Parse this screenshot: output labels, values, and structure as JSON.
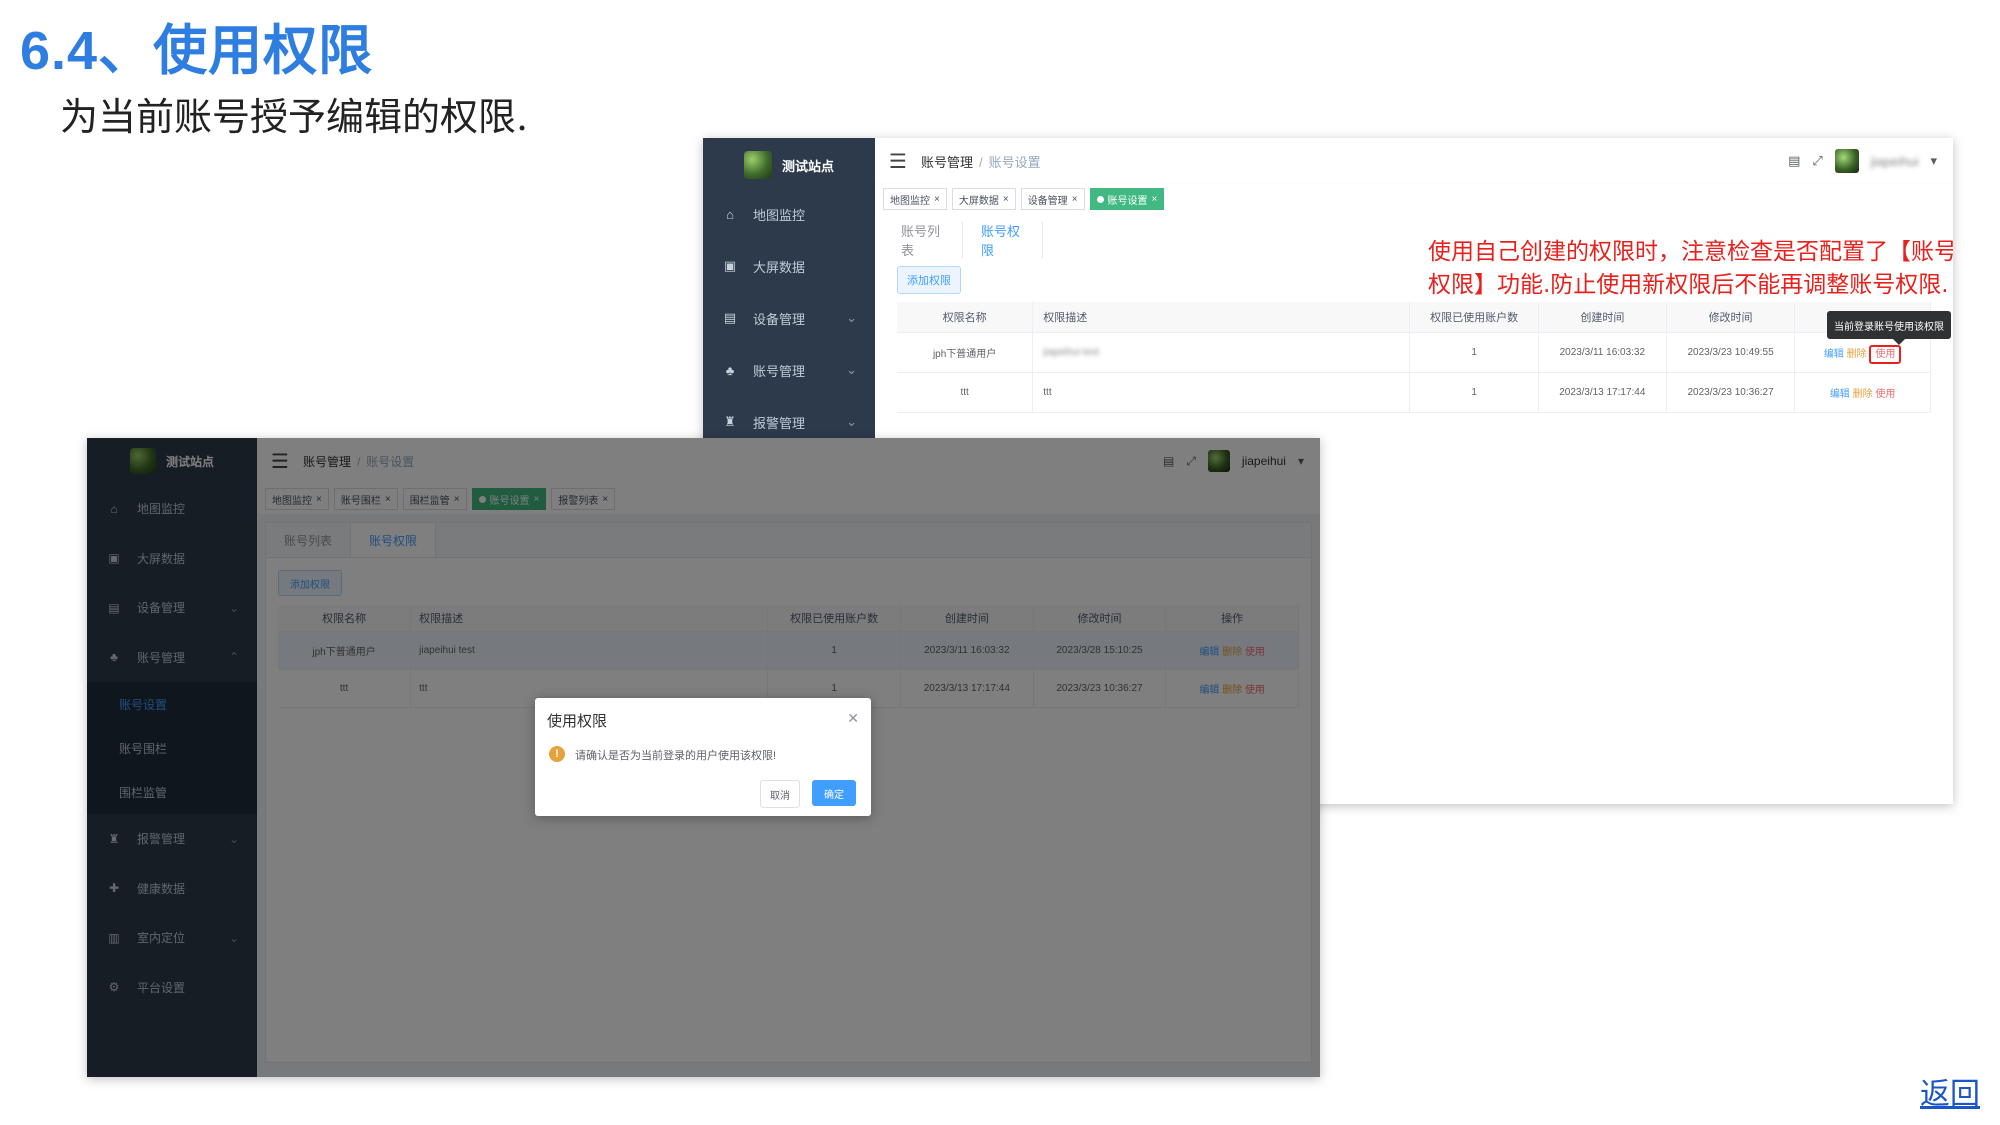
{
  "slide": {
    "title": "6.4、使用权限",
    "subtitle": "为当前账号授予编辑的权限.",
    "back_link": "返回"
  },
  "shot_back": {
    "logo_text": "测试站点",
    "menu": [
      "地图监控",
      "大屏数据",
      "设备管理",
      "账号管理",
      "报警管理"
    ],
    "breadcrumb": {
      "parent": "账号管理",
      "sep": "/",
      "current": "账号设置"
    },
    "user": "jiapeihui",
    "tags": [
      "地图监控",
      "大屏数据",
      "设备管理",
      "账号设置"
    ],
    "tabs": [
      "账号列表",
      "账号权限"
    ],
    "add_button": "添加权限",
    "columns": [
      "权限名称",
      "权限描述",
      "权限已使用账户数",
      "创建时间",
      "修改时间",
      ""
    ],
    "rows": [
      {
        "name": "jph下普通用户",
        "desc": "jiapeihui test",
        "count": "1",
        "created": "2023/3/11 16:03:32",
        "modified": "2023/3/23 10:49:55"
      },
      {
        "name": "ttt",
        "desc": "ttt",
        "count": "1",
        "created": "2023/3/13 17:17:44",
        "modified": "2023/3/23 10:36:27"
      }
    ],
    "ops": {
      "edit": "编辑",
      "delete": "删除",
      "use": "使用"
    },
    "tooltip": "当前登录账号使用该权限",
    "callout": "使用自己创建的权限时，注意检查是否配置了【账号权限】功能.防止使用新权限后不能再调整账号权限."
  },
  "shot_front": {
    "logo_text": "测试站点",
    "menu_top": [
      "地图监控",
      "大屏数据",
      "设备管理",
      "账号管理"
    ],
    "submenu": [
      "账号设置",
      "账号围栏",
      "围栏监管"
    ],
    "menu_bottom": [
      "报警管理",
      "健康数据",
      "室内定位",
      "平台设置"
    ],
    "breadcrumb": {
      "parent": "账号管理",
      "sep": "/",
      "current": "账号设置"
    },
    "user": "jiapeihui",
    "tags": [
      "地图监控",
      "账号围栏",
      "围栏监管",
      "账号设置",
      "报警列表"
    ],
    "tabs": [
      "账号列表",
      "账号权限"
    ],
    "add_button": "添加权限",
    "columns": [
      "权限名称",
      "权限描述",
      "权限已使用账户数",
      "创建时间",
      "修改时间",
      "操作"
    ],
    "rows": [
      {
        "name": "jph下普通用户",
        "desc": "jiapeihui test",
        "count": "1",
        "created": "2023/3/11 16:03:32",
        "modified": "2023/3/28 15:10:25"
      },
      {
        "name": "ttt",
        "desc": "ttt",
        "count": "1",
        "created": "2023/3/13 17:17:44",
        "modified": "2023/3/23 10:36:27"
      }
    ],
    "ops": {
      "edit": "编辑",
      "delete": "删除",
      "use": "使用"
    },
    "dialog": {
      "title": "使用权限",
      "message": "请确认是否为当前登录的用户使用该权限!",
      "cancel": "取消",
      "confirm": "确定"
    }
  },
  "colors": {
    "accent": "#409eff",
    "active_tag": "#42b983",
    "sidebar": "#2d3a4b",
    "callout": "#e8211c",
    "title": "#2e7de1"
  }
}
